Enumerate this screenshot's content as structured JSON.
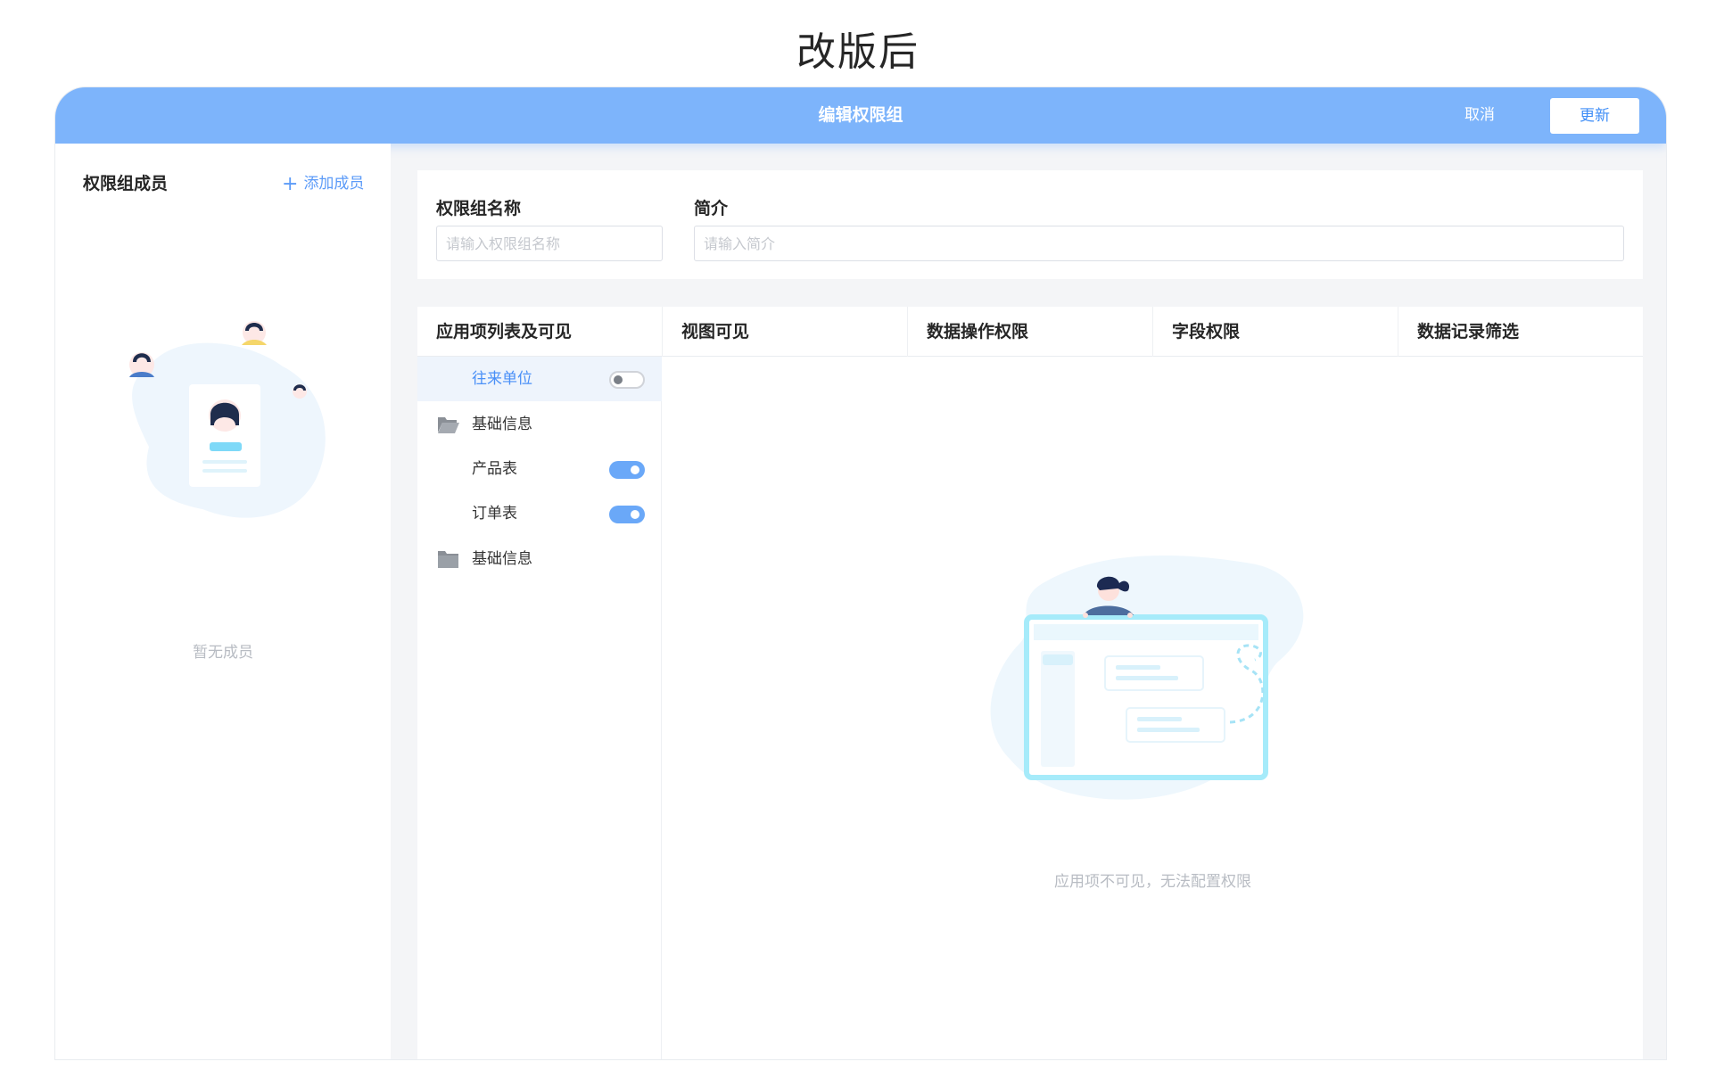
{
  "page": {
    "heading": "改版后"
  },
  "topbar": {
    "title": "编辑权限组",
    "cancel_label": "取消",
    "update_label": "更新"
  },
  "members": {
    "title": "权限组成员",
    "add_label": "添加成员",
    "empty_text": "暂无成员"
  },
  "form": {
    "name_label": "权限组名称",
    "name_placeholder": "请输入权限组名称",
    "desc_label": "简介",
    "desc_placeholder": "请输入简介"
  },
  "table": {
    "headers": [
      "应用项列表及可见",
      "视图可见",
      "数据操作权限",
      "字段权限",
      "数据记录筛选"
    ],
    "items": [
      {
        "label": "往来单位",
        "type": "app",
        "toggle": "off",
        "active": true
      },
      {
        "label": "基础信息",
        "type": "folder",
        "icon": "folder-open-icon"
      },
      {
        "label": "产品表",
        "type": "app",
        "toggle": "on"
      },
      {
        "label": "订单表",
        "type": "app",
        "toggle": "on"
      },
      {
        "label": "基础信息",
        "type": "folder",
        "icon": "folder-icon"
      }
    ],
    "empty_text": "应用项不可见，无法配置权限"
  },
  "colors": {
    "accent": "#7db4fb",
    "link": "#5c9bf8",
    "toggle_on": "#6aa8f8"
  }
}
